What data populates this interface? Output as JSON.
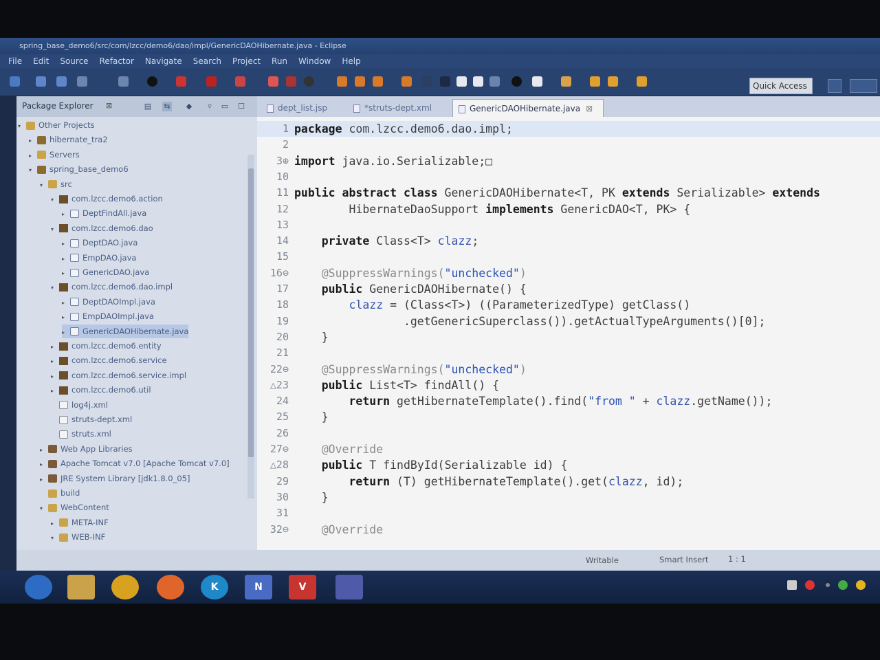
{
  "window": {
    "title": "spring_base_demo6/src/com/lzcc/demo6/dao/impl/GenericDAOHibernate.java - Eclipse"
  },
  "menu": [
    "File",
    "Edit",
    "Source",
    "Refactor",
    "Navigate",
    "Search",
    "Project",
    "Run",
    "Window",
    "Help"
  ],
  "toolbar": {
    "quick_access": "Quick Access"
  },
  "package_explorer": {
    "title": "Package Explorer",
    "close": "⊠",
    "tree": [
      {
        "label": "Other Projects",
        "indent": 0,
        "icon": "folder",
        "arrow": "▾"
      },
      {
        "label": "hibernate_tra2",
        "indent": 1,
        "icon": "proj",
        "arrow": "▸"
      },
      {
        "label": "Servers",
        "indent": 1,
        "icon": "folder",
        "arrow": "▸"
      },
      {
        "label": "spring_base_demo6",
        "indent": 1,
        "icon": "proj",
        "arrow": "▾"
      },
      {
        "label": "src",
        "indent": 2,
        "icon": "folder",
        "arrow": "▾"
      },
      {
        "label": "com.lzcc.demo6.action",
        "indent": 3,
        "icon": "pkg",
        "arrow": "▾"
      },
      {
        "label": "DeptFindAll.java",
        "indent": 4,
        "icon": "java",
        "arrow": "▸"
      },
      {
        "label": "com.lzcc.demo6.dao",
        "indent": 3,
        "icon": "pkg",
        "arrow": "▾"
      },
      {
        "label": "DeptDAO.java",
        "indent": 4,
        "icon": "java",
        "arrow": "▸"
      },
      {
        "label": "EmpDAO.java",
        "indent": 4,
        "icon": "java",
        "arrow": "▸"
      },
      {
        "label": "GenericDAO.java",
        "indent": 4,
        "icon": "java",
        "arrow": "▸"
      },
      {
        "label": "com.lzcc.demo6.dao.impl",
        "indent": 3,
        "icon": "pkg",
        "arrow": "▾"
      },
      {
        "label": "DeptDAOImpl.java",
        "indent": 4,
        "icon": "java",
        "arrow": "▸"
      },
      {
        "label": "EmpDAOImpl.java",
        "indent": 4,
        "icon": "java",
        "arrow": "▸"
      },
      {
        "label": "GenericDAOHibernate.java",
        "indent": 4,
        "icon": "java",
        "arrow": "▸",
        "selected": true
      },
      {
        "label": "com.lzcc.demo6.entity",
        "indent": 3,
        "icon": "pkg",
        "arrow": "▸"
      },
      {
        "label": "com.lzcc.demo6.service",
        "indent": 3,
        "icon": "pkg",
        "arrow": "▸"
      },
      {
        "label": "com.lzcc.demo6.service.impl",
        "indent": 3,
        "icon": "pkg",
        "arrow": "▸"
      },
      {
        "label": "com.lzcc.demo6.util",
        "indent": 3,
        "icon": "pkg",
        "arrow": "▸"
      },
      {
        "label": "log4j.xml",
        "indent": 3,
        "icon": "xml",
        "arrow": ""
      },
      {
        "label": "struts-dept.xml",
        "indent": 3,
        "icon": "xml",
        "arrow": ""
      },
      {
        "label": "struts.xml",
        "indent": 3,
        "icon": "xml",
        "arrow": ""
      },
      {
        "label": "Web App Libraries",
        "indent": 2,
        "icon": "lib",
        "arrow": "▸"
      },
      {
        "label": "Apache Tomcat v7.0 [Apache Tomcat v7.0]",
        "indent": 2,
        "icon": "lib",
        "arrow": "▸"
      },
      {
        "label": "JRE System Library [jdk1.8.0_05]",
        "indent": 2,
        "icon": "lib",
        "arrow": "▸"
      },
      {
        "label": "build",
        "indent": 2,
        "icon": "folder",
        "arrow": ""
      },
      {
        "label": "WebContent",
        "indent": 2,
        "icon": "folder",
        "arrow": "▾"
      },
      {
        "label": "META-INF",
        "indent": 3,
        "icon": "folder",
        "arrow": "▸"
      },
      {
        "label": "WEB-INF",
        "indent": 3,
        "icon": "folder",
        "arrow": "▾"
      }
    ]
  },
  "editor": {
    "tabs": [
      {
        "label": "dept_list.jsp",
        "active": false
      },
      {
        "label": "*struts-dept.xml",
        "active": false
      },
      {
        "label": "GenericDAOHibernate.java",
        "active": true,
        "close": "⊠"
      }
    ],
    "lines": [
      {
        "n": "1",
        "segs": [
          [
            "kw",
            "package"
          ],
          [
            "",
            "com.lzcc.demo6.dao.impl;"
          ]
        ],
        "hl": true
      },
      {
        "n": "2",
        "segs": []
      },
      {
        "n": "3⊕",
        "segs": [
          [
            "kw",
            "import"
          ],
          [
            "",
            " java.io.Serializable;□"
          ]
        ]
      },
      {
        "n": "10",
        "segs": []
      },
      {
        "n": "11",
        "segs": [
          [
            "kw",
            "public abstract class"
          ],
          [
            "",
            " GenericDAOHibernate<T, PK "
          ],
          [
            "kw",
            "extends"
          ],
          [
            "",
            " Serializable> "
          ],
          [
            "kw",
            "extends"
          ]
        ]
      },
      {
        "n": "12",
        "segs": [
          [
            "",
            "        HibernateDaoSupport "
          ],
          [
            "kw",
            "implements"
          ],
          [
            "",
            " GenericDAO<T, PK> {"
          ]
        ]
      },
      {
        "n": "13",
        "segs": []
      },
      {
        "n": "14",
        "segs": [
          [
            "",
            "    "
          ],
          [
            "kw",
            "private"
          ],
          [
            "",
            " Class<T> "
          ],
          [
            "fld",
            "clazz"
          ],
          [
            "",
            ";"
          ]
        ]
      },
      {
        "n": "15",
        "segs": []
      },
      {
        "n": "16⊖",
        "segs": [
          [
            "ann",
            "    @SuppressWarnings("
          ],
          [
            "str",
            "\"unchecked\""
          ],
          [
            "ann",
            ")"
          ]
        ]
      },
      {
        "n": "17",
        "segs": [
          [
            "",
            "    "
          ],
          [
            "kw",
            "public"
          ],
          [
            "",
            " GenericDAOHibernate() {"
          ]
        ]
      },
      {
        "n": "18",
        "segs": [
          [
            "",
            "        "
          ],
          [
            "fld",
            "clazz"
          ],
          [
            "",
            " = (Class<T>) ((ParameterizedType) getClass()"
          ]
        ]
      },
      {
        "n": "19",
        "segs": [
          [
            "",
            "                .getGenericSuperclass()).getActualTypeArguments()[0];"
          ]
        ]
      },
      {
        "n": "20",
        "segs": [
          [
            "",
            "    }"
          ]
        ]
      },
      {
        "n": "21",
        "segs": []
      },
      {
        "n": "22⊖",
        "segs": [
          [
            "ann",
            "    @SuppressWarnings("
          ],
          [
            "str",
            "\"unchecked\""
          ],
          [
            "ann",
            ")"
          ]
        ]
      },
      {
        "n": "△23",
        "segs": [
          [
            "",
            "    "
          ],
          [
            "kw",
            "public"
          ],
          [
            "",
            " List<T> findAll() {"
          ]
        ]
      },
      {
        "n": "24",
        "segs": [
          [
            "",
            "        "
          ],
          [
            "kw",
            "return"
          ],
          [
            "",
            " getHibernateTemplate().find("
          ],
          [
            "str",
            "\"from \""
          ],
          [
            "",
            " + "
          ],
          [
            "fld",
            "clazz"
          ],
          [
            "",
            ".getName());"
          ]
        ]
      },
      {
        "n": "25",
        "segs": [
          [
            "",
            "    }"
          ]
        ]
      },
      {
        "n": "26",
        "segs": []
      },
      {
        "n": "27⊖",
        "segs": [
          [
            "ann",
            "    @Override"
          ]
        ]
      },
      {
        "n": "△28",
        "segs": [
          [
            "",
            "    "
          ],
          [
            "kw",
            "public"
          ],
          [
            "",
            " T findById(Serializable id) {"
          ]
        ]
      },
      {
        "n": "29",
        "segs": [
          [
            "",
            "        "
          ],
          [
            "kw",
            "return"
          ],
          [
            "",
            " (T) getHibernateTemplate().get("
          ],
          [
            "fld",
            "clazz"
          ],
          [
            "",
            ", id);"
          ]
        ]
      },
      {
        "n": "30",
        "segs": [
          [
            "",
            "    }"
          ]
        ]
      },
      {
        "n": "31",
        "segs": []
      },
      {
        "n": "32⊖",
        "segs": [
          [
            "ann",
            "    @Override"
          ]
        ]
      }
    ]
  },
  "status": {
    "writable": "Writable",
    "insert": "Smart Insert",
    "position": "1 : 1"
  },
  "taskbar": {
    "apps": [
      {
        "name": "start-orb",
        "label": "",
        "color": "#2e6bc4"
      },
      {
        "name": "file-explorer",
        "label": "",
        "color": "#c9a24a"
      },
      {
        "name": "chrome",
        "label": "",
        "color": "#d8a11f"
      },
      {
        "name": "firefox",
        "label": "",
        "color": "#e0652a"
      },
      {
        "name": "k-app",
        "label": "K",
        "color": "#1e88c9"
      },
      {
        "name": "onenote",
        "label": "N",
        "color": "#4a6bc4"
      },
      {
        "name": "vs-app",
        "label": "V",
        "color": "#c8342f"
      },
      {
        "name": "eclipse",
        "label": "",
        "color": "#4f5aa8"
      }
    ]
  }
}
